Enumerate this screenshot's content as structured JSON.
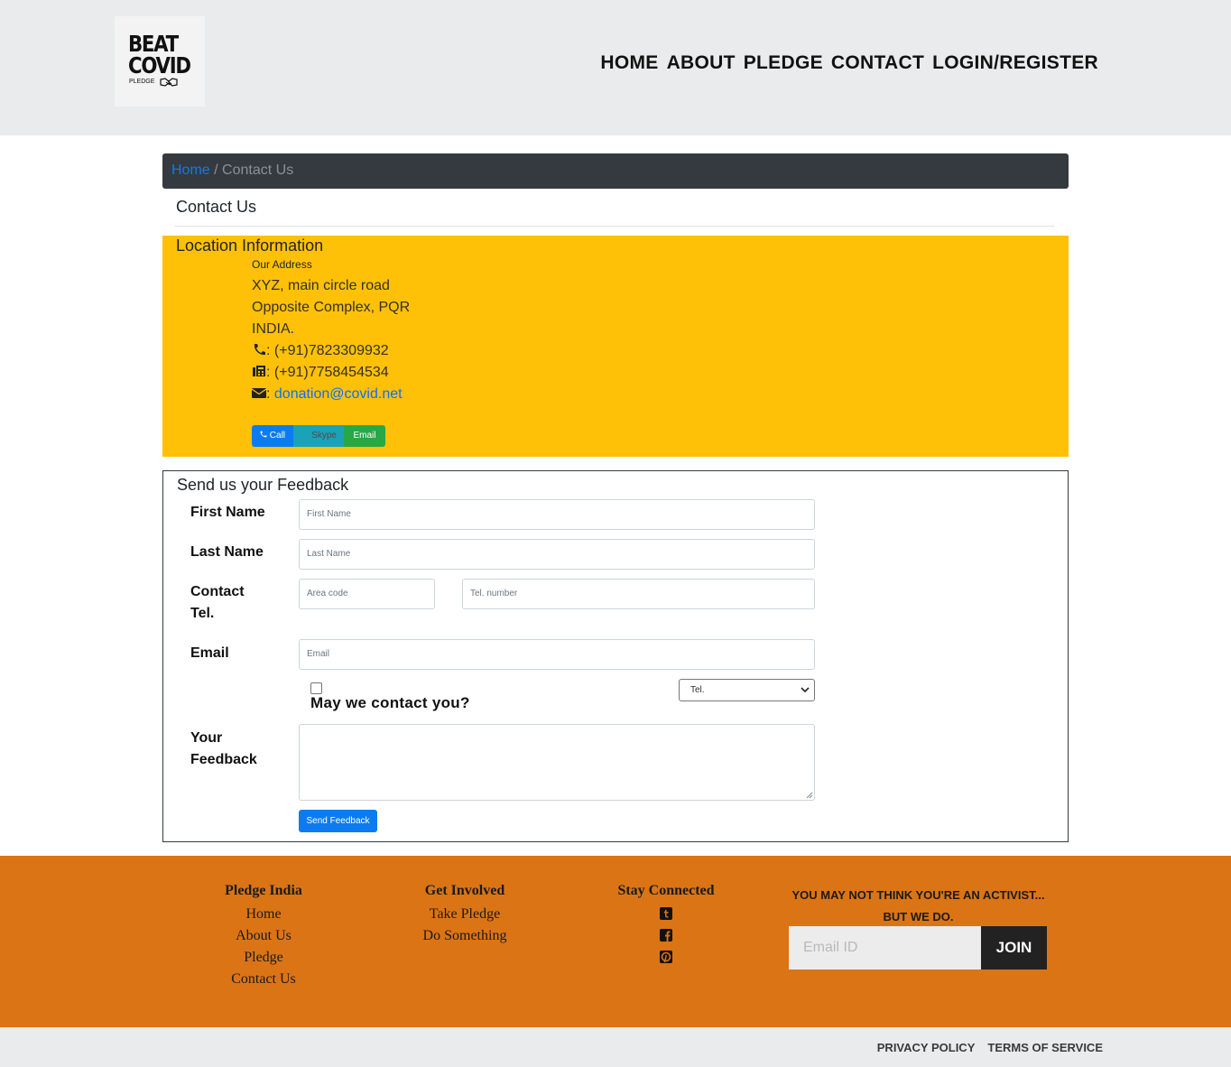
{
  "logo": {
    "line1": "BEAT",
    "line2": "COVID",
    "line3": "PLEDGE"
  },
  "nav": {
    "items": [
      "HOME",
      "ABOUT",
      "PLEDGE",
      "CONTACT",
      "LOGIN/REGISTER"
    ]
  },
  "breadcrumb": {
    "home": "Home",
    "separator": "/",
    "current": "Contact Us"
  },
  "page": {
    "title": "Contact Us"
  },
  "location": {
    "title": "Location Information",
    "address_label": "Our Address",
    "address_lines": [
      "XYZ, main circle road",
      "Opposite Complex, PQR",
      "INDIA."
    ],
    "phone": ": (+91)7823309932",
    "fax": ": (+91)7758454534",
    "email_prefix": ": ",
    "email": "donation@covid.net",
    "buttons": {
      "call": "Call",
      "skype": "Skype",
      "email": "Email"
    }
  },
  "feedback": {
    "title": "Send us your Feedback",
    "first_name_label": "First Name",
    "first_name_placeholder": "First Name",
    "last_name_label": "Last Name",
    "last_name_placeholder": "Last Name",
    "contact_label_1": "Contact",
    "contact_label_2": "Tel.",
    "area_code_placeholder": "Area code",
    "tel_placeholder": "Tel. number",
    "email_label": "Email",
    "email_placeholder": "Email",
    "contact_consent_label": "May we contact you?",
    "contact_method_selected": "Tel.",
    "your_feedback_label_1": "Your",
    "your_feedback_label_2": "Feedback",
    "send_label": "Send Feedback"
  },
  "footer": {
    "col1": {
      "heading": "Pledge India",
      "items": [
        "Home",
        "About Us",
        "Pledge",
        "Contact Us"
      ]
    },
    "col2": {
      "heading": "Get Involved",
      "items": [
        "Take Pledge",
        "Do Something"
      ]
    },
    "col3": {
      "heading": "Stay Connected",
      "icons": [
        "tumblr-icon",
        "facebook-icon",
        "pinterest-icon"
      ]
    },
    "activist_line1": "YOU MAY NOT THINK YOU'RE AN ACTIVIST...",
    "activist_line2": "BUT WE DO.",
    "email_placeholder": "Email ID",
    "join_label": "JOIN"
  },
  "bottom": {
    "privacy": "PRIVACY POLICY",
    "terms": "TERMS OF SERVICE"
  },
  "colors": {
    "header_bg": "#eaebec",
    "breadcrumb_bg": "#343a40",
    "location_bg": "#fec107",
    "footer_bg": "#db7415",
    "primary": "#0d7bf0"
  }
}
